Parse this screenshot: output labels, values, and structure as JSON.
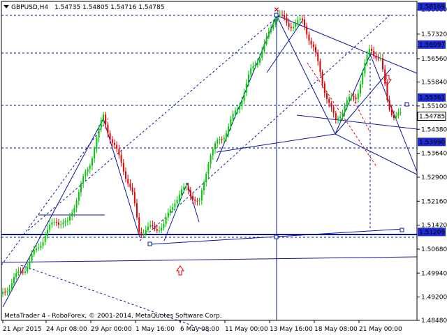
{
  "header": {
    "symbol_tf": "GBPUSD,H4",
    "ohlc": "1.54735 1.54805 1.54716 1.54785",
    "arrow_icon": "triangle-down-icon"
  },
  "footer": {
    "copyright": "MetaTrader 4 - RoboForex, © 2001-2014, MetaQuotes Software Corp."
  },
  "colors": {
    "bull": "#00c800",
    "bear": "#e00000",
    "line": "#0a14a0",
    "level_label_bg": "#1e2ad2",
    "level_label_text": "#ffffff",
    "grid_text": "#000000"
  },
  "chart_data": {
    "type": "candlestick",
    "symbol": "GBPUSD",
    "timeframe": "H4",
    "ylim": [
      1.4848,
      1.5833
    ],
    "y_ticks": [
      {
        "value": 1.5808,
        "label": "1.58080"
      },
      {
        "value": 1.5732,
        "label": "1.57320"
      },
      {
        "value": 1.5656,
        "label": "1.56560"
      },
      {
        "value": 1.5584,
        "label": "1.55840"
      },
      {
        "value": 1.551,
        "label": "1.55100"
      },
      {
        "value": 1.5438,
        "label": "1.54380"
      },
      {
        "value": 1.5364,
        "label": "1.53640"
      },
      {
        "value": 1.529,
        "label": "1.52900"
      },
      {
        "value": 1.5216,
        "label": "1.52160"
      },
      {
        "value": 1.5142,
        "label": "1.51420"
      },
      {
        "value": 1.5068,
        "label": "1.50680"
      },
      {
        "value": 1.4994,
        "label": "1.49940"
      },
      {
        "value": 1.492,
        "label": "1.49200"
      },
      {
        "value": 1.4848,
        "label": "1.48480"
      }
    ],
    "x_ticks": [
      "21 Apr 2015",
      "24 Apr 08:00",
      "29 Apr 00:00",
      "1 May 16:00",
      "6 May 08:00",
      "11 May 00:00",
      "13 May 16:00",
      "18 May 08:00",
      "21 May 00:00"
    ],
    "levels": [
      {
        "value": 1.58169,
        "label": "1.58169"
      },
      {
        "value": 1.56997,
        "label": "1.56997"
      },
      {
        "value": 1.55361,
        "label": "1.55361"
      },
      {
        "value": 1.54785,
        "label": "1.54785"
      },
      {
        "value": 1.5399,
        "label": "1.53990"
      },
      {
        "value": 1.51209,
        "label": "1.51209"
      }
    ],
    "current_price": 1.54785,
    "grid": false,
    "legend": "none"
  }
}
